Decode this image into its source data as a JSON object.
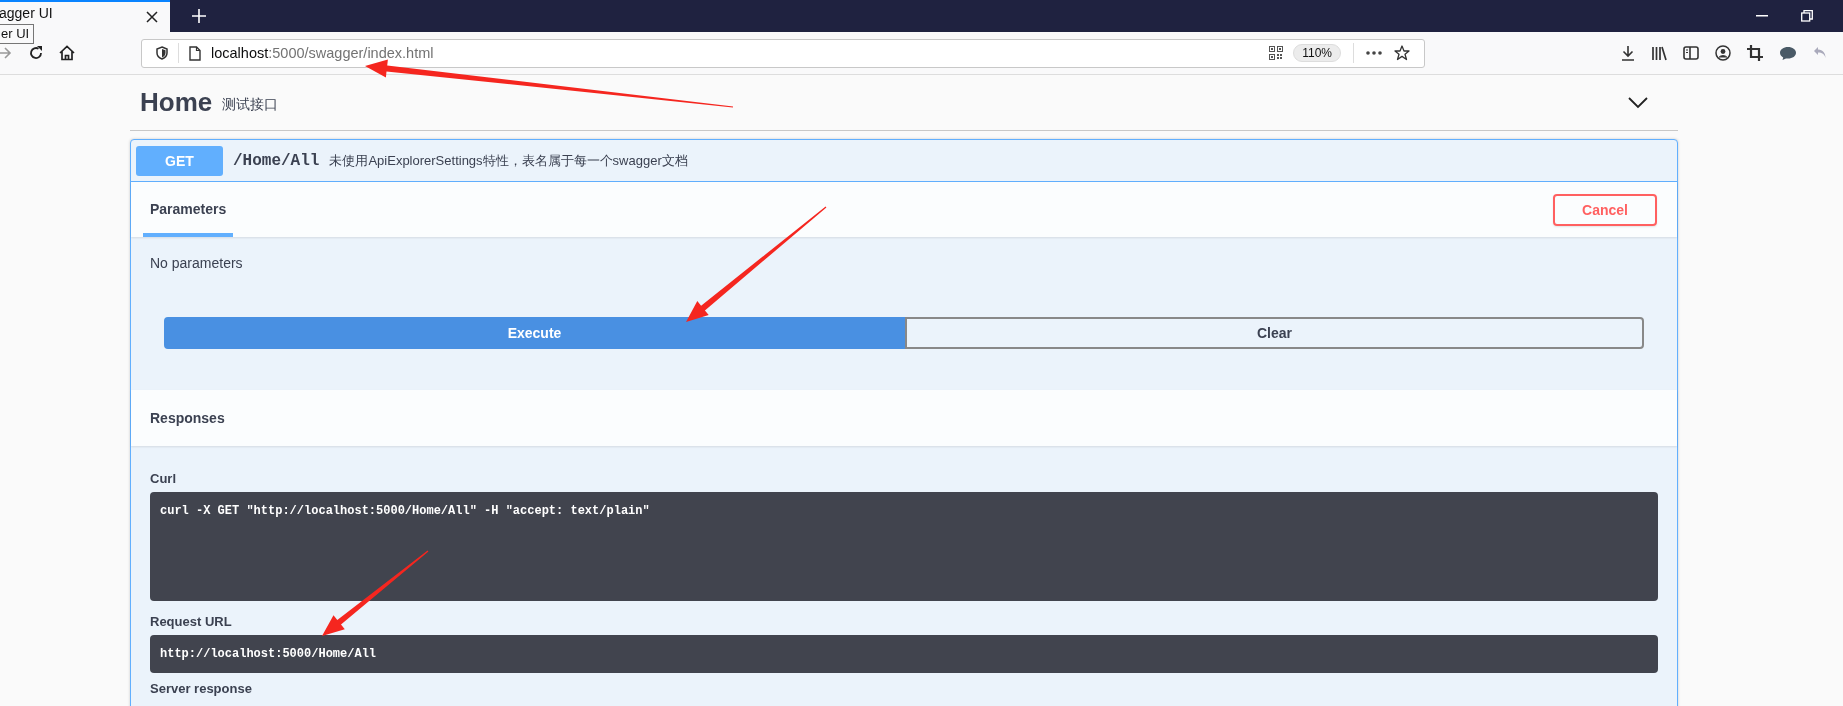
{
  "browser": {
    "tab": {
      "title": "agger UI",
      "selected": true
    },
    "tooltip": "er UI",
    "address": {
      "host": "localhost",
      "path": ":5000/swagger/index.html"
    },
    "zoom": "110%"
  },
  "section": {
    "title": "Home",
    "description": "测试接口",
    "expanded": true
  },
  "operation": {
    "method": "GET",
    "path": "/Home/All",
    "summary": "未使用ApiExplorerSettings特性，表名属于每一个swagger文档",
    "tabs": [
      {
        "label": "Parameters",
        "selected": true
      }
    ],
    "cancel": "Cancel",
    "no_params": "No parameters",
    "execute": "Execute",
    "clear": "Clear",
    "responses_title": "Responses",
    "curl_label": "Curl",
    "curl": "curl -X GET \"http://localhost:5000/Home/All\" -H \"accept: text/plain\"",
    "request_url_label": "Request URL",
    "request_url": "http://localhost:5000/Home/All",
    "server_response_label": "Server response"
  }
}
